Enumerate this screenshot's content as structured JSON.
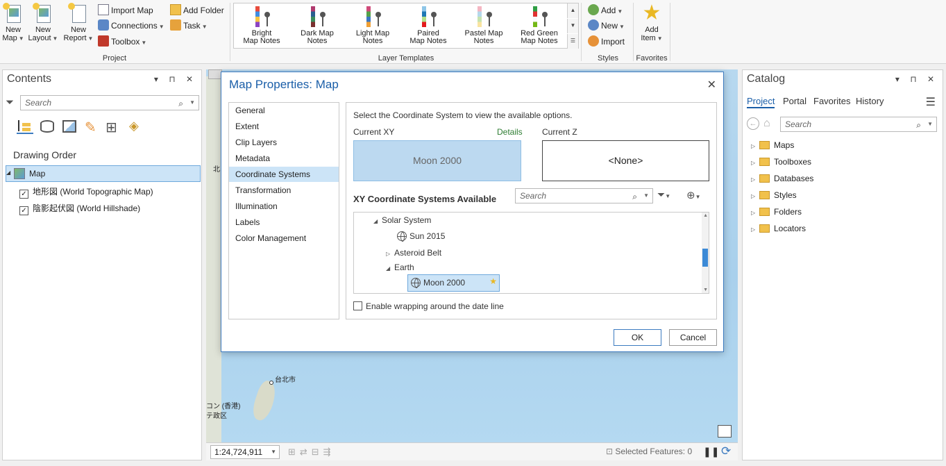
{
  "ribbon": {
    "project": {
      "new_map": "New Map",
      "new_layout": "New Layout",
      "new_report": "New Report",
      "import_map": "Import Map",
      "connections": "Connections",
      "toolbox": "Toolbox",
      "add_folder": "Add Folder",
      "task": "Task",
      "group_label": "Project"
    },
    "layer_templates": {
      "items": [
        {
          "l1": "Bright",
          "l2": "Map Notes",
          "colors": [
            "#e84c3d",
            "#3f8de3",
            "#f6c544",
            "#8c44c3"
          ]
        },
        {
          "l1": "Dark Map",
          "l2": "Notes",
          "colors": [
            "#b03a6e",
            "#2b5f8f",
            "#3a8c5a",
            "#7a2f2f"
          ]
        },
        {
          "l1": "Light Map",
          "l2": "Notes",
          "colors": [
            "#d04b7a",
            "#54a24b",
            "#3b78c4",
            "#f0a035"
          ]
        },
        {
          "l1": "Paired",
          "l2": "Map Notes",
          "colors": [
            "#8ec6e8",
            "#1f78b4",
            "#b2df8a",
            "#e31a1c"
          ]
        },
        {
          "l1": "Pastel Map",
          "l2": "Notes",
          "colors": [
            "#f4b6c2",
            "#b5d8eb",
            "#c5e3b0",
            "#f9e4a1"
          ]
        },
        {
          "l1": "Red Green",
          "l2": "Map Notes",
          "colors": [
            "#2f9e44",
            "#e03131",
            "#f8f9fa",
            "#74b816"
          ]
        }
      ],
      "group_label": "Layer Templates"
    },
    "styles": {
      "add": "Add",
      "new": "New",
      "import": "Import",
      "group_label": "Styles"
    },
    "favorites": {
      "add_item": "Add Item",
      "group_label": "Favorites"
    }
  },
  "contents": {
    "title": "Contents",
    "search_placeholder": "Search",
    "drawing_order": "Drawing Order",
    "map_item": "Map",
    "layers": [
      "地形図 (World Topographic Map)",
      "陰影起伏図 (World Hillshade)"
    ]
  },
  "map": {
    "labels": [
      "北",
      "台北市",
      "コン (香港)",
      "テ政区"
    ],
    "scale": "1:24,724,911",
    "selected_features": "Selected Features: 0"
  },
  "dialog": {
    "title": "Map Properties: Map",
    "nav": [
      "General",
      "Extent",
      "Clip Layers",
      "Metadata",
      "Coordinate Systems",
      "Transformation",
      "Illumination",
      "Labels",
      "Color Management"
    ],
    "selected_nav": "Coordinate Systems",
    "instructions": "Select the Coordinate System to view the available options.",
    "current_xy_label": "Current XY",
    "details_link": "Details",
    "current_xy_value": "Moon 2000",
    "current_z_label": "Current Z",
    "current_z_value": "<None>",
    "available_label": "XY Coordinate Systems Available",
    "search_placeholder": "Search",
    "tree": {
      "solar_system": "Solar System",
      "sun": "Sun 2015",
      "asteroid_belt": "Asteroid Belt",
      "earth": "Earth",
      "moon": "Moon 2000"
    },
    "wrap_label": "Enable wrapping around the date line",
    "wrap_checked": false,
    "ok": "OK",
    "cancel": "Cancel"
  },
  "catalog": {
    "title": "Catalog",
    "tabs": [
      "Project",
      "Portal",
      "Favorites",
      "History"
    ],
    "active_tab": "Project",
    "search_placeholder": "Search",
    "items": [
      "Maps",
      "Toolboxes",
      "Databases",
      "Styles",
      "Folders",
      "Locators"
    ]
  }
}
